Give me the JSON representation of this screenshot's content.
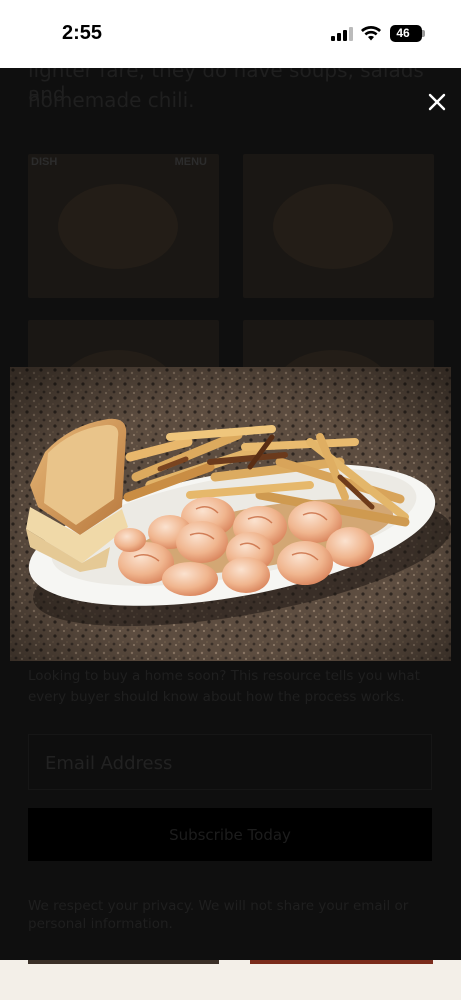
{
  "status_bar": {
    "time": "2:55",
    "battery": "46"
  },
  "page": {
    "intro_line1": "lighter fare, they do have soups, salads and",
    "intro_line2": "homemade chili.",
    "thumb1_tag_left": "DISH",
    "thumb1_tag_right": "MENU",
    "blurb_line1": "Looking to buy a home soon? This resource tells you what",
    "blurb_line2": "every buyer should know about how the process works.",
    "email_placeholder": "Email Address",
    "subscribe_label": "Subscribe Today",
    "privacy_line1": "We respect your privacy.  We will not share your email or",
    "privacy_line2": "personal information."
  },
  "lightbox": {
    "close_icon": "close-icon",
    "photo_subject": "shrimp-fries-toast-plate"
  },
  "colors": {
    "overlay": "#0f0f0f",
    "footer": "#f3efe8",
    "granite": "#5a4a3c",
    "plate": "#f4f4f2"
  }
}
